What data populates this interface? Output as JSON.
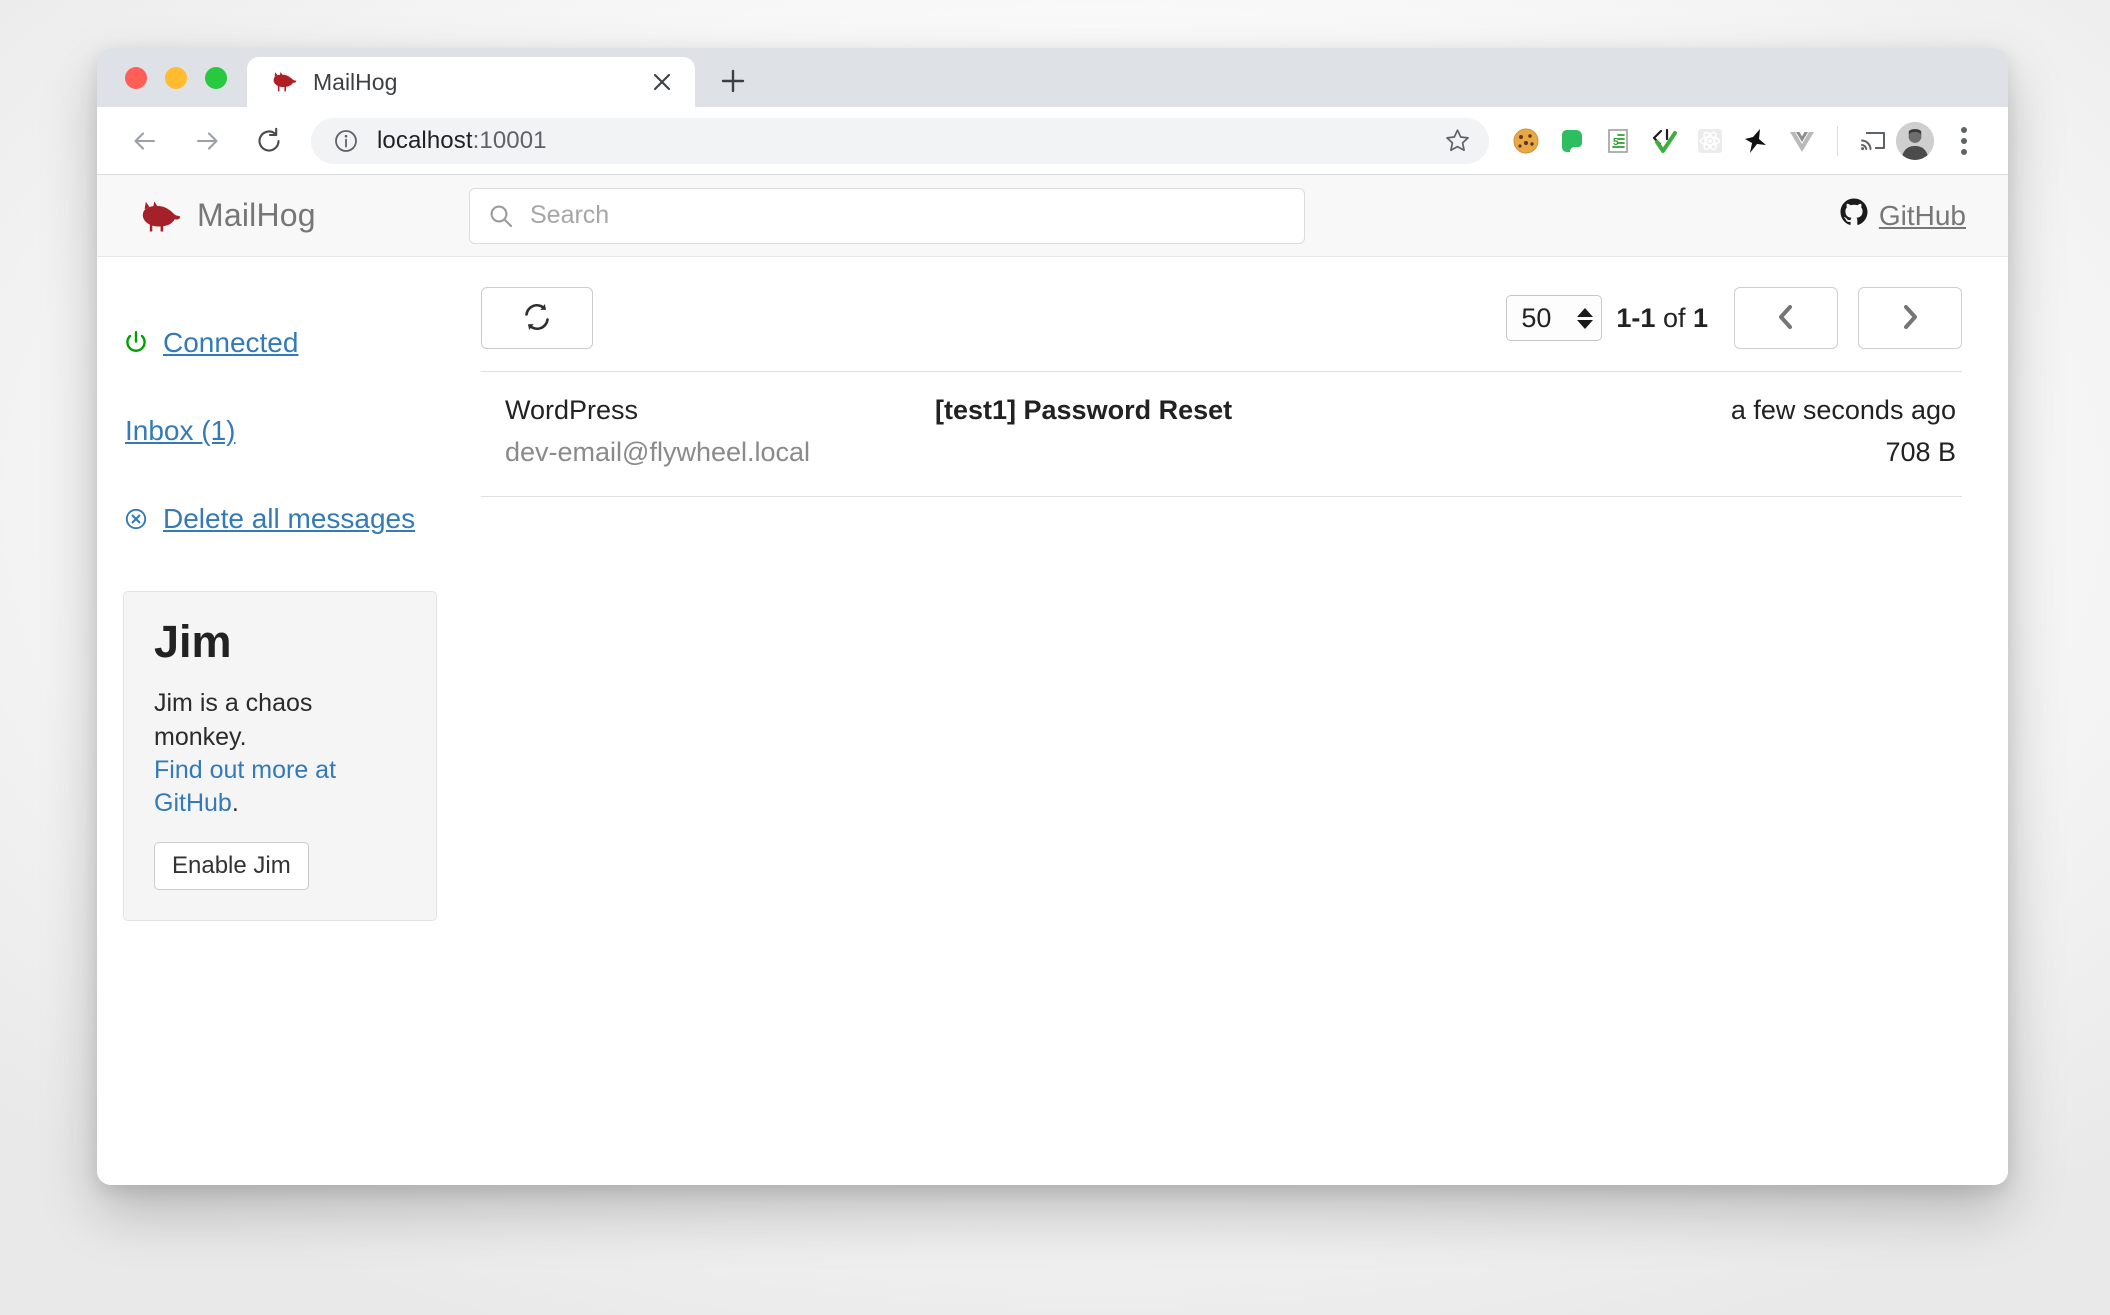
{
  "browser": {
    "tab": {
      "title": "MailHog",
      "favicon_icon": "pig-favicon",
      "close_icon": "close-icon"
    },
    "new_tab_icon": "plus-icon",
    "nav": {
      "back_icon": "back-arrow-icon",
      "forward_icon": "forward-arrow-icon",
      "reload_icon": "reload-icon"
    },
    "omnibox": {
      "info_icon": "info-circle-icon",
      "url_host": "localhost",
      "url_port": ":10001",
      "star_icon": "star-icon"
    },
    "extensions": [
      {
        "name": "cookie-extension-icon"
      },
      {
        "name": "evernote-extension-icon"
      },
      {
        "name": "list-document-extension-icon"
      },
      {
        "name": "code-check-extension-icon"
      },
      {
        "name": "react-devtools-extension-icon"
      },
      {
        "name": "pin-extension-icon"
      },
      {
        "name": "vue-devtools-extension-icon"
      }
    ],
    "cast_icon": "cast-icon",
    "avatar_icon": "profile-avatar",
    "menu_icon": "kebab-menu-icon"
  },
  "app": {
    "brand": {
      "logo_icon": "mailhog-pig-logo",
      "name": "MailHog",
      "logo_color": "#a52028"
    },
    "search": {
      "icon": "search-icon",
      "value": "",
      "placeholder": "Search"
    },
    "github": {
      "icon": "github-icon",
      "label": "GitHub"
    }
  },
  "sidebar": {
    "items": [
      {
        "label": "Connected",
        "icon": "power-icon",
        "icon_color": "#00a000"
      },
      {
        "label": "Inbox (1)",
        "icon": "none"
      },
      {
        "label": "Delete all messages",
        "icon": "delete-circle-icon"
      }
    ],
    "jim": {
      "title": "Jim",
      "description": "Jim is a chaos monkey.",
      "link_label": "Find out more at GitHub",
      "link_suffix": ".",
      "button_label": "Enable Jim"
    }
  },
  "list": {
    "refresh_icon": "refresh-icon",
    "page_size": "50",
    "range_label": "1-1",
    "of_label": " of ",
    "total_label": "1",
    "prev_icon": "chevron-left-icon",
    "next_icon": "chevron-right-icon",
    "messages": [
      {
        "from_name": "WordPress",
        "from_address": "dev-email@flywheel.local",
        "subject": "[test1] Password Reset",
        "received": "a few seconds ago",
        "size": "708 B"
      }
    ]
  },
  "colors": {
    "link": "#337ab7",
    "brand_red": "#a52028",
    "connected_green": "#00a000"
  }
}
